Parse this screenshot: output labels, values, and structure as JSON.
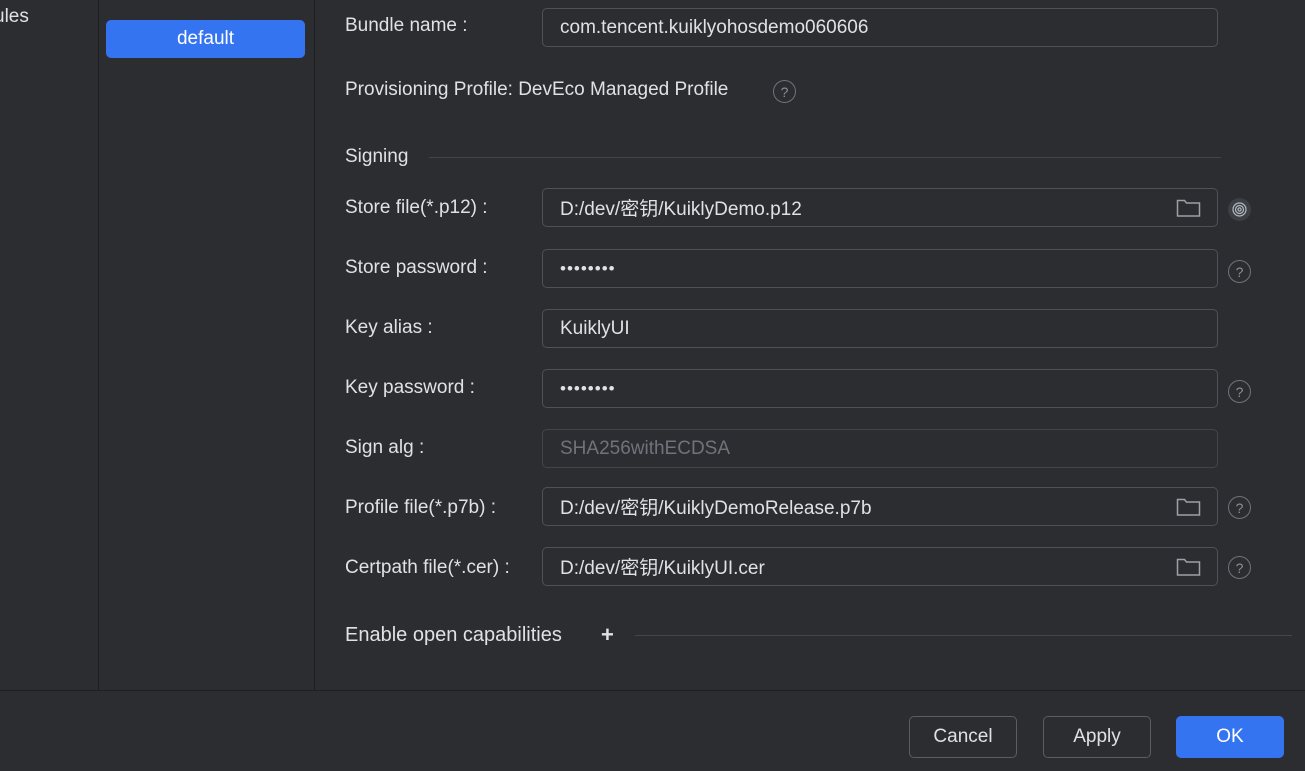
{
  "modules": {
    "label": "ules"
  },
  "targets": {
    "selected": "default"
  },
  "form": {
    "bundle_name_label": "Bundle name :",
    "bundle_name_value": "com.tencent.kuiklyohosdemo060606",
    "provisioning_label": "Provisioning Profile: DevEco Managed Profile",
    "signing_title": "Signing",
    "store_file_label": "Store file(*.p12) :",
    "store_file_value": "D:/dev/密钥/KuiklyDemo.p12",
    "store_password_label": "Store password :",
    "store_password_value": "••••••••",
    "key_alias_label": "Key alias :",
    "key_alias_value": "KuiklyUI",
    "key_password_label": "Key password :",
    "key_password_value": "••••••••",
    "sign_alg_label": "Sign alg :",
    "sign_alg_value": "SHA256withECDSA",
    "profile_file_label": "Profile file(*.p7b) :",
    "profile_file_value": "D:/dev/密钥/KuiklyDemoRelease.p7b",
    "certpath_file_label": "Certpath file(*.cer) :",
    "certpath_file_value": "D:/dev/密钥/KuiklyUI.cer",
    "capabilities_title": "Enable open capabilities",
    "capabilities_add": "+"
  },
  "help_glyph": "?",
  "buttons": {
    "cancel": "Cancel",
    "apply": "Apply",
    "ok": "OK"
  },
  "colors": {
    "accent": "#3574f0",
    "background": "#2b2d30"
  }
}
